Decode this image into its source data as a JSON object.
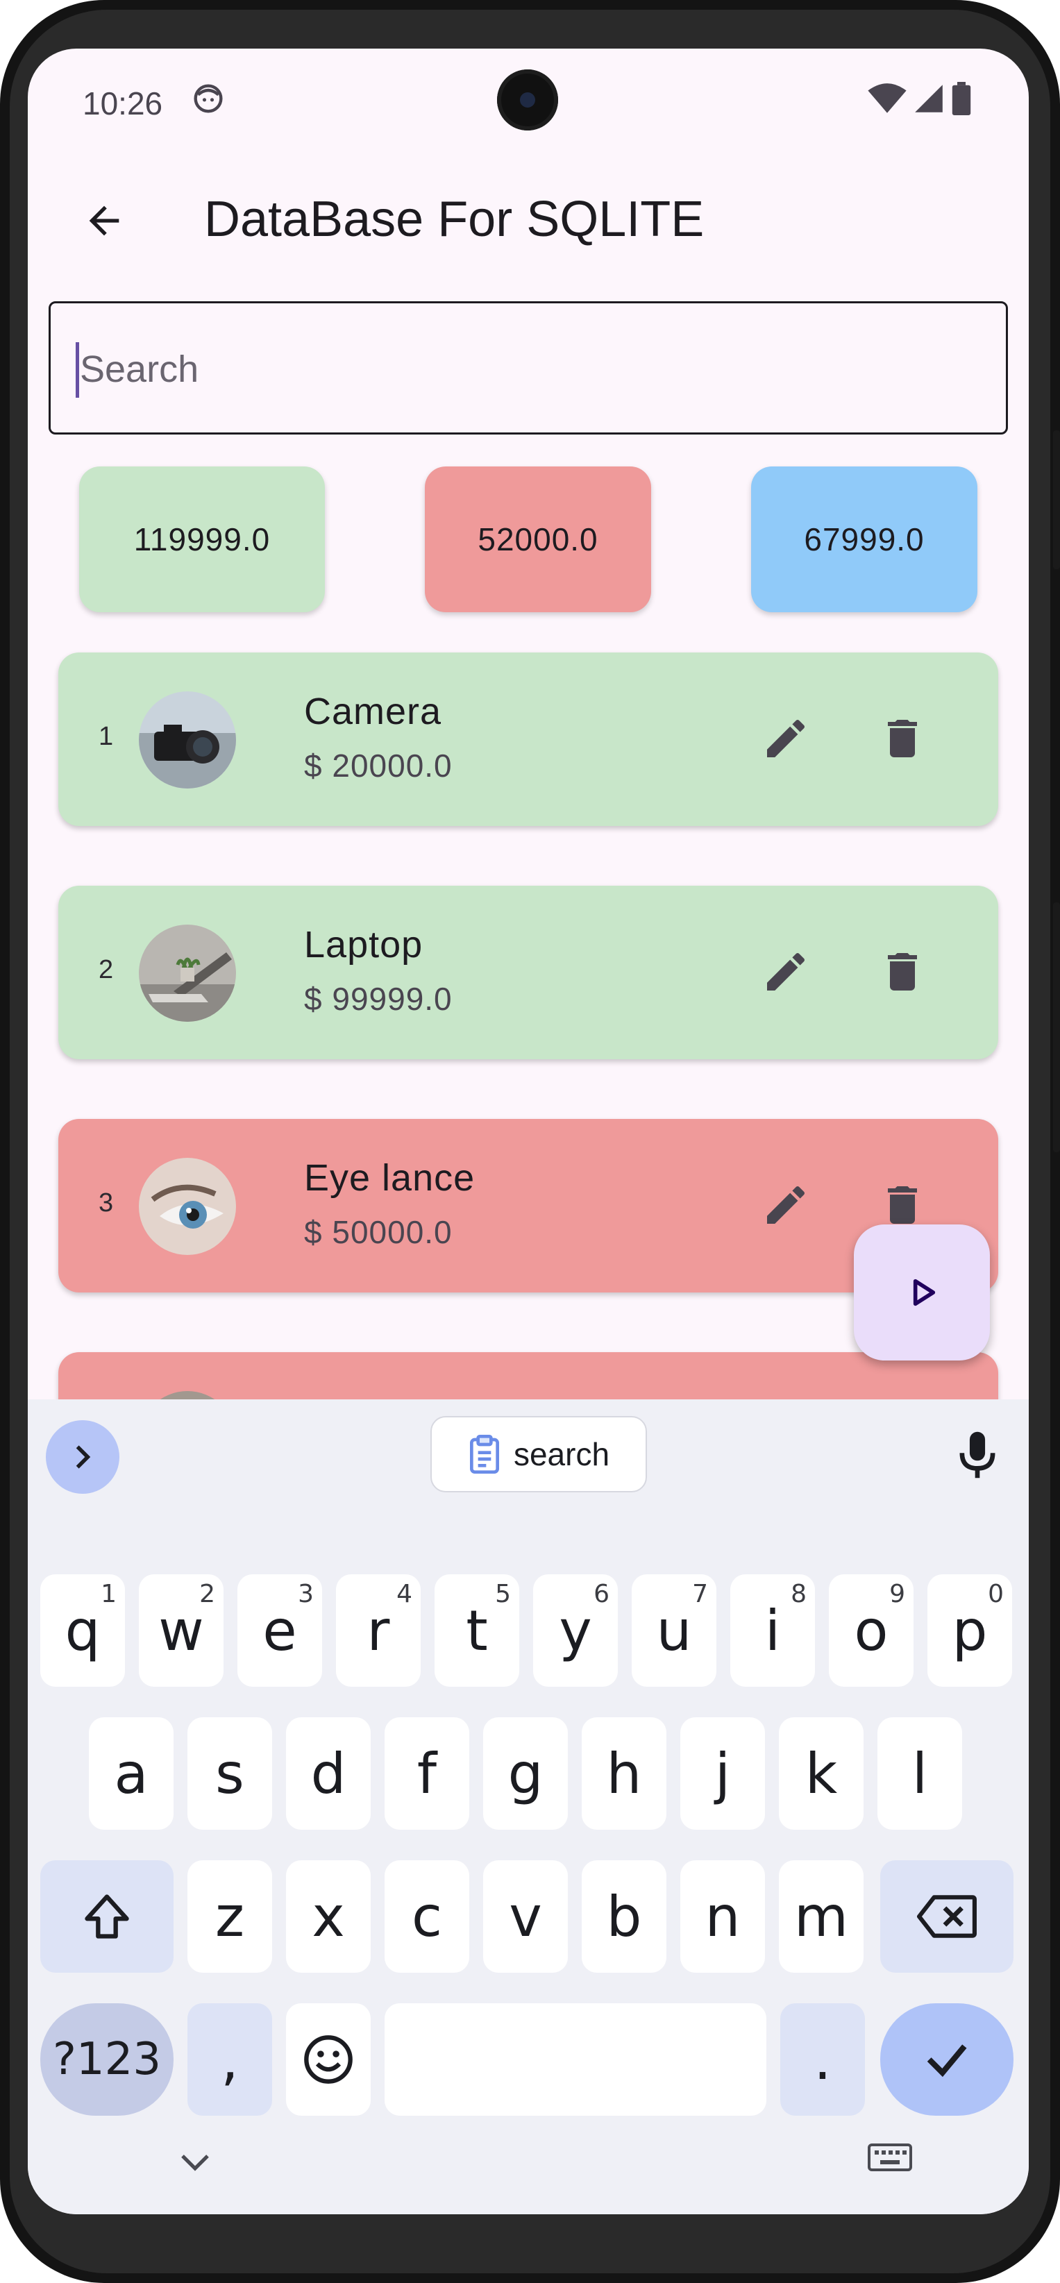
{
  "status_bar": {
    "time": "10:26"
  },
  "app_bar": {
    "title": "DataBase For SQLITE"
  },
  "search": {
    "placeholder": "Search",
    "value": ""
  },
  "totals": [
    {
      "value": "119999.0",
      "color": "#c8e6c9"
    },
    {
      "value": "52000.0",
      "color": "#ef9a9a"
    },
    {
      "value": "67999.0",
      "color": "#90caf9"
    }
  ],
  "items": [
    {
      "index": "1",
      "name": "Camera",
      "price": "$ 20000.0",
      "color": "#c8e6c9",
      "image": "camera-photo"
    },
    {
      "index": "2",
      "name": "Laptop",
      "price": "$ 99999.0",
      "color": "#c8e6c9",
      "image": "laptop-photo"
    },
    {
      "index": "3",
      "name": "Eye lance",
      "price": "$ 50000.0",
      "color": "#ef9a9a",
      "image": "eye-photo"
    }
  ],
  "keyboard": {
    "suggestion": "search",
    "row1": [
      {
        "label": "q",
        "hint": "1"
      },
      {
        "label": "w",
        "hint": "2"
      },
      {
        "label": "e",
        "hint": "3"
      },
      {
        "label": "r",
        "hint": "4"
      },
      {
        "label": "t",
        "hint": "5"
      },
      {
        "label": "y",
        "hint": "6"
      },
      {
        "label": "u",
        "hint": "7"
      },
      {
        "label": "i",
        "hint": "8"
      },
      {
        "label": "o",
        "hint": "9"
      },
      {
        "label": "p",
        "hint": "0"
      }
    ],
    "row2": [
      "a",
      "s",
      "d",
      "f",
      "g",
      "h",
      "j",
      "k",
      "l"
    ],
    "row3": [
      "z",
      "x",
      "c",
      "v",
      "b",
      "n",
      "m"
    ],
    "symbols_label": "?123",
    "comma_label": ",",
    "period_label": "."
  }
}
